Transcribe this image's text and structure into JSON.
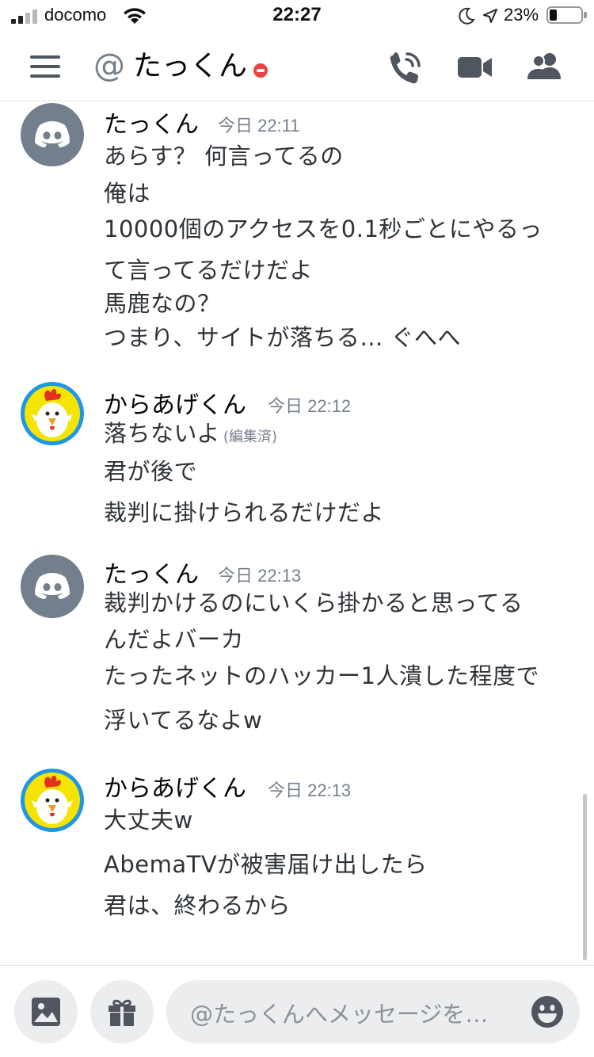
{
  "status_bar": {
    "carrier": "docomo",
    "time": "22:27",
    "battery_percent": "23%",
    "battery_level": 0.23,
    "signal_bars": 2,
    "icons": [
      "wifi-icon",
      "moon-icon",
      "location-arrow-icon",
      "battery-icon"
    ]
  },
  "header": {
    "at_symbol": "@",
    "channel_name": "たっくん",
    "status": "do-not-disturb",
    "status_color": "#ed4245",
    "icons": [
      "hamburger-menu-icon",
      "phone-call-icon",
      "video-camera-icon",
      "members-icon"
    ]
  },
  "messages": [
    {
      "username": "たっくん",
      "timestamp": "今日 22:11",
      "avatar": "discord-default",
      "lines": [
        "あらす？ 何言ってるの",
        "俺は",
        "10000個のアクセスを0.1秒ごとにやるっ",
        "て言ってるだけだよ",
        "馬鹿なの？",
        "つまり、サイトが落ちる… ぐへへ"
      ]
    },
    {
      "username": "からあげくん",
      "timestamp": "今日 22:12",
      "avatar": "chicken",
      "lines": [
        "落ちないよ",
        "君が後で",
        "裁判に掛けられるだけだよ"
      ],
      "edited_label": "(編集済)"
    },
    {
      "username": "たっくん",
      "timestamp": "今日 22:13",
      "avatar": "discord-default",
      "lines": [
        "裁判かけるのにいくら掛かると思ってる",
        "んだよバーカ",
        "たったネットのハッカー1人潰した程度で",
        "浮いてるなよw"
      ]
    },
    {
      "username": "からあげくん",
      "timestamp": "今日 22:13",
      "avatar": "chicken",
      "lines": [
        "大丈夫w",
        "AbemaTVが被害届け出したら",
        "君は、終わるから"
      ]
    }
  ],
  "composer": {
    "placeholder": "@たっくんへメッセージを…",
    "icons": [
      "image-icon",
      "gift-icon",
      "emoji-icon"
    ]
  },
  "colors": {
    "discord_avatar": "#747f8d",
    "chicken_avatar_ring": "#1f96e6",
    "chicken_avatar_bg": "#f5e400",
    "muted_text": "#747f8d",
    "input_bg": "#ebedef"
  }
}
